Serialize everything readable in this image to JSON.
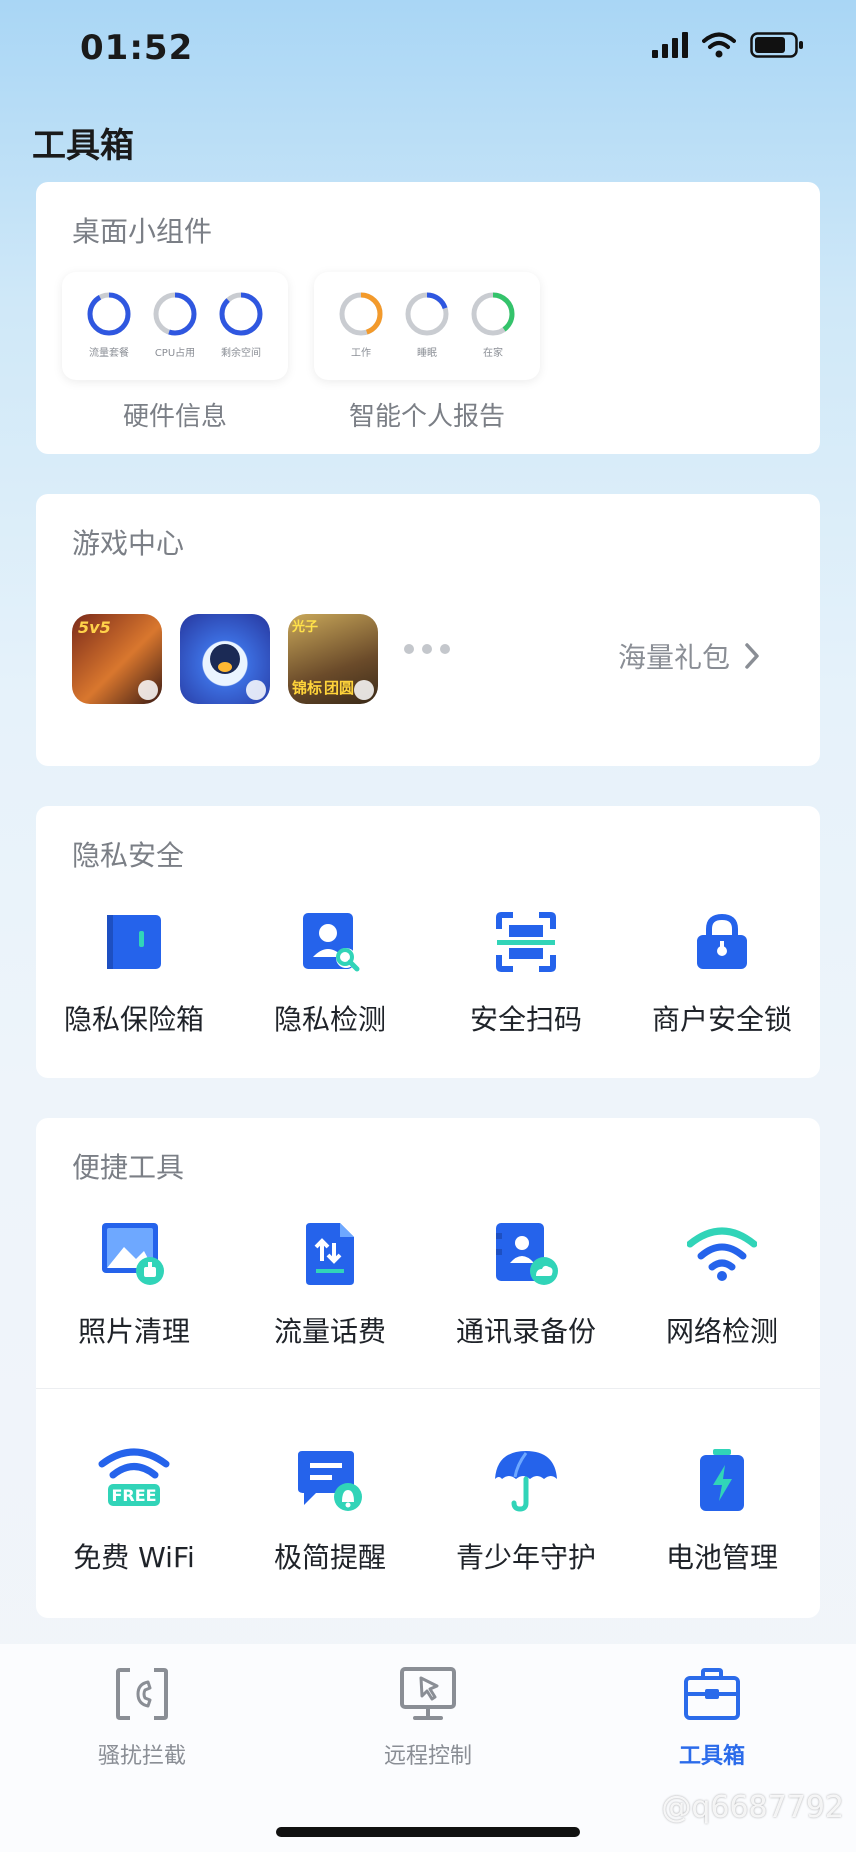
{
  "status": {
    "time": "01:52"
  },
  "page": {
    "title": "工具箱"
  },
  "widgets": {
    "title": "桌面小组件",
    "groups": [
      {
        "caption": "硬件信息",
        "rings": [
          {
            "label": "流量套餐",
            "color": "#2f57e0",
            "value": 0.92
          },
          {
            "label": "CPU占用",
            "color": "#2f57e0",
            "value": 0.55
          },
          {
            "label": "剩余空间",
            "color": "#2f57e0",
            "value": 0.88
          }
        ]
      },
      {
        "caption": "智能个人报告",
        "rings": [
          {
            "label": "工作",
            "color": "#f39a2b",
            "value": 0.45
          },
          {
            "label": "睡眠",
            "color": "#2f57e0",
            "value": 0.2
          },
          {
            "label": "在家",
            "color": "#34c36b",
            "value": 0.4
          }
        ]
      }
    ]
  },
  "games": {
    "title": "游戏中心",
    "gift_label": "海量礼包",
    "icon_texts": [
      "5v5",
      "光子",
      "锦标",
      "团圆"
    ]
  },
  "privacy": {
    "title": "隐私安全",
    "items": [
      {
        "label": "隐私保险箱",
        "icon": "safe-box-icon"
      },
      {
        "label": "隐私检测",
        "icon": "privacy-check-icon"
      },
      {
        "label": "安全扫码",
        "icon": "scan-code-icon"
      },
      {
        "label": "商户安全锁",
        "icon": "lock-icon"
      }
    ]
  },
  "tools": {
    "title": "便捷工具",
    "row1": [
      {
        "label": "照片清理",
        "icon": "photo-clean-icon"
      },
      {
        "label": "流量话费",
        "icon": "data-bill-icon"
      },
      {
        "label": "通讯录备份",
        "icon": "contacts-backup-icon"
      },
      {
        "label": "网络检测",
        "icon": "wifi-check-icon"
      }
    ],
    "row2": [
      {
        "label": "免费 WiFi",
        "icon": "free-wifi-icon",
        "badge": "FREE"
      },
      {
        "label": "极简提醒",
        "icon": "reminder-icon"
      },
      {
        "label": "青少年守护",
        "icon": "umbrella-icon"
      },
      {
        "label": "电池管理",
        "icon": "battery-manage-icon"
      }
    ]
  },
  "tabs": [
    {
      "label": "骚扰拦截",
      "icon": "phone-block-icon",
      "active": false
    },
    {
      "label": "远程控制",
      "icon": "remote-control-icon",
      "active": false
    },
    {
      "label": "工具箱",
      "icon": "toolbox-icon",
      "active": true
    }
  ],
  "watermark": "@q6687792",
  "colors": {
    "accent": "#2b6bea",
    "teal": "#31d4b8"
  }
}
